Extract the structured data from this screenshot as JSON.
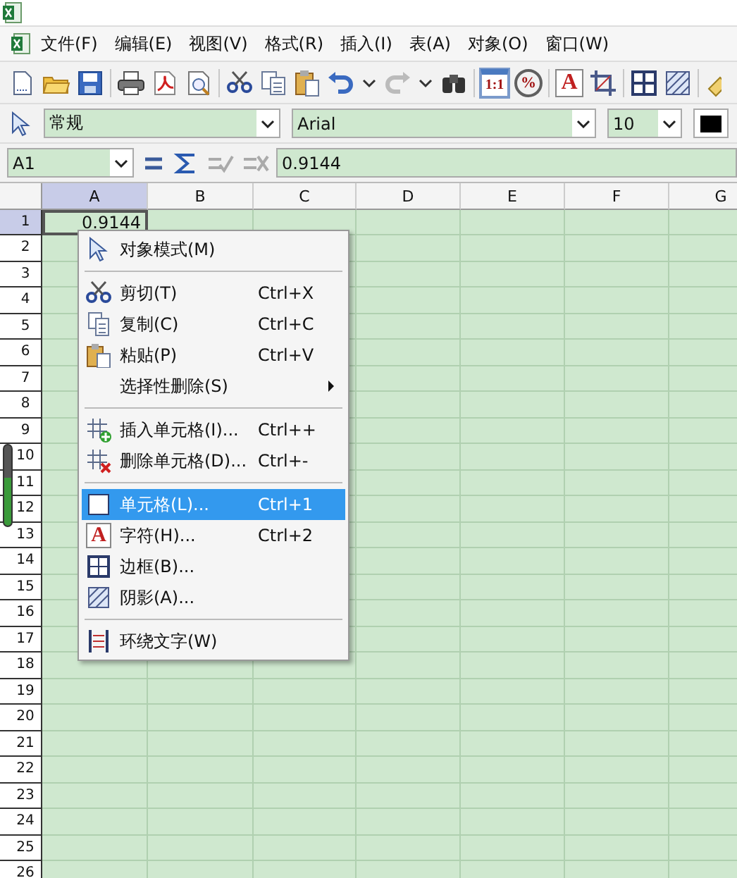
{
  "menu_bar": [
    {
      "label": "文件(F)"
    },
    {
      "label": "编辑(E)"
    },
    {
      "label": "视图(V)"
    },
    {
      "label": "格式(R)"
    },
    {
      "label": "插入(I)"
    },
    {
      "label": "表(A)"
    },
    {
      "label": "对象(O)"
    },
    {
      "label": "窗口(W)"
    }
  ],
  "toolbar": [
    {
      "kind": "new",
      "pressed": false
    },
    {
      "kind": "open",
      "pressed": false
    },
    {
      "kind": "save",
      "pressed": false
    },
    {
      "kind": "separator"
    },
    {
      "kind": "print",
      "pressed": false
    },
    {
      "kind": "pdf",
      "pressed": false
    },
    {
      "kind": "preview",
      "pressed": false
    },
    {
      "kind": "separator"
    },
    {
      "kind": "cut",
      "pressed": false
    },
    {
      "kind": "copy",
      "pressed": false
    },
    {
      "kind": "paste",
      "pressed": false
    },
    {
      "kind": "undo",
      "pressed": false
    },
    {
      "kind": "dropdown",
      "pressed": false
    },
    {
      "kind": "redo",
      "pressed": false
    },
    {
      "kind": "dropdown",
      "pressed": false
    },
    {
      "kind": "find",
      "pressed": false
    },
    {
      "kind": "separator"
    },
    {
      "kind": "zoom-actual",
      "label": "1:1",
      "pressed": true
    },
    {
      "kind": "zoom",
      "label": "%",
      "pressed": false
    },
    {
      "kind": "separator"
    },
    {
      "kind": "character",
      "label": "A",
      "pressed": false
    },
    {
      "kind": "crop",
      "pressed": false
    },
    {
      "kind": "separator"
    },
    {
      "kind": "borders",
      "pressed": false
    },
    {
      "kind": "shade",
      "pressed": false
    },
    {
      "kind": "separator"
    },
    {
      "kind": "eraser",
      "pressed": false
    }
  ],
  "format_bar": {
    "style": "常规",
    "font": "Arial",
    "size": "10"
  },
  "formula_bar": {
    "cell": "A1",
    "value": "0.9144"
  },
  "sheet": {
    "columns": [
      {
        "label": "A",
        "selected": true
      },
      {
        "label": "B",
        "selected": false
      },
      {
        "label": "C",
        "selected": false
      },
      {
        "label": "D",
        "selected": false
      },
      {
        "label": "E",
        "selected": false
      },
      {
        "label": "F",
        "selected": false
      },
      {
        "label": "G",
        "selected": false
      }
    ],
    "rows": [
      {
        "label": "1",
        "selected": true,
        "cells": [
          "0.9144"
        ]
      },
      {
        "label": "2",
        "selected": false
      },
      {
        "label": "3",
        "selected": false
      },
      {
        "label": "4",
        "selected": false
      },
      {
        "label": "5",
        "selected": false
      },
      {
        "label": "6",
        "selected": false
      },
      {
        "label": "7",
        "selected": false
      },
      {
        "label": "8",
        "selected": false
      },
      {
        "label": "9",
        "selected": false
      },
      {
        "label": "10",
        "selected": false
      },
      {
        "label": "11",
        "selected": false
      },
      {
        "label": "12",
        "selected": false
      },
      {
        "label": "13",
        "selected": false
      },
      {
        "label": "14",
        "selected": false
      },
      {
        "label": "15",
        "selected": false
      },
      {
        "label": "16",
        "selected": false
      },
      {
        "label": "17",
        "selected": false
      },
      {
        "label": "18",
        "selected": false
      },
      {
        "label": "19",
        "selected": false
      },
      {
        "label": "20",
        "selected": false
      },
      {
        "label": "21",
        "selected": false
      },
      {
        "label": "22",
        "selected": false
      },
      {
        "label": "23",
        "selected": false
      },
      {
        "label": "24",
        "selected": false
      },
      {
        "label": "25",
        "selected": false
      },
      {
        "label": "26",
        "selected": false
      }
    ]
  },
  "context_menu": [
    {
      "kind": "item",
      "label": "对象模式(M)",
      "selected": false
    },
    {
      "kind": "separator"
    },
    {
      "kind": "item",
      "label": "剪切(T)",
      "shortcut": "Ctrl+X",
      "selected": false
    },
    {
      "kind": "item",
      "label": "复制(C)",
      "shortcut": "Ctrl+C",
      "selected": false
    },
    {
      "kind": "item",
      "label": "粘贴(P)",
      "shortcut": "Ctrl+V",
      "selected": false
    },
    {
      "kind": "submenu",
      "label": "选择性删除(S)",
      "selected": false
    },
    {
      "kind": "separator"
    },
    {
      "kind": "item",
      "label": "插入单元格(I)...",
      "shortcut": "Ctrl++",
      "selected": false
    },
    {
      "kind": "item",
      "label": "删除单元格(D)...",
      "shortcut": "Ctrl+-",
      "selected": false
    },
    {
      "kind": "separator"
    },
    {
      "kind": "item",
      "label": "单元格(L)...",
      "shortcut": "Ctrl+1",
      "selected": true
    },
    {
      "kind": "item",
      "glyph": "A",
      "label": "字符(H)...",
      "shortcut": "Ctrl+2",
      "selected": false
    },
    {
      "kind": "item",
      "label": "边框(B)...",
      "selected": false
    },
    {
      "kind": "item",
      "label": "阴影(A)...",
      "selected": false
    },
    {
      "kind": "separator"
    },
    {
      "kind": "item",
      "label": "环绕文字(W)",
      "selected": false
    }
  ]
}
